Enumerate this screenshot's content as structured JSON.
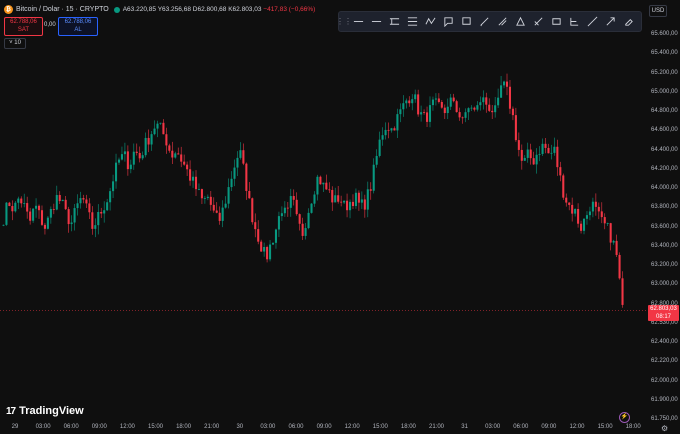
{
  "header": {
    "symbol": "Bitcoin / Dolar · 15 · CRYPTO",
    "ohlc": {
      "open": "A63.220,85",
      "high": "Y63.256,68",
      "low": "D62.800,68",
      "close": "K62.803,03",
      "change": "−417,83 (−0,66%)"
    },
    "sell": {
      "price": "62.788,06",
      "label": "SAT"
    },
    "spread": "0,00",
    "buy": {
      "price": "62.788,06",
      "label": "AL"
    },
    "indicator_count": "10"
  },
  "toolbar": {
    "tools": [
      "horizontal-line-icon",
      "ray-icon",
      "parallel-channel-icon",
      "fib-icon",
      "pattern-icon",
      "text-icon",
      "callout-icon",
      "brush-icon",
      "ruler-icon",
      "triangle-icon",
      "measure-icon",
      "rectangle-icon",
      "position-icon",
      "trendline-icon",
      "arrow-icon",
      "eraser-icon"
    ]
  },
  "currency": "USD",
  "current_price": {
    "price": "62.803,03",
    "countdown": "08:17"
  },
  "y_axis": {
    "labels": [
      "65.600,00",
      "65.400,00",
      "65.200,00",
      "65.000,00",
      "64.800,00",
      "64.600,00",
      "64.400,00",
      "64.200,00",
      "64.000,00",
      "63.800,00",
      "63.600,00",
      "63.400,00",
      "63.200,00",
      "63.000,00",
      "62.800,00",
      "62.530,00",
      "62.400,00",
      "62.220,00",
      "62.000,00",
      "61.900,00",
      "61.750,00"
    ]
  },
  "x_axis": {
    "labels": [
      "29",
      "03:00",
      "06:00",
      "09:00",
      "12:00",
      "15:00",
      "18:00",
      "21:00",
      "30",
      "03:00",
      "06:00",
      "09:00",
      "12:00",
      "15:00",
      "18:00",
      "21:00",
      "31",
      "03:00",
      "06:00",
      "09:00",
      "12:00",
      "15:00",
      "18:00"
    ]
  },
  "branding": {
    "logo_text": "TradingView",
    "logo_mark": "17"
  },
  "colors": {
    "up": "#089981",
    "down": "#f23645",
    "background": "#0f0f0f"
  },
  "chart_data": {
    "type": "candlestick",
    "title": "",
    "ylim": [
      61750,
      65700
    ],
    "close_path": [
      63700,
      63850,
      63780,
      63900,
      63800,
      63650,
      63820,
      63700,
      63600,
      63750,
      63900,
      63850,
      63720,
      63650,
      63800,
      63900,
      63750,
      63600,
      63700,
      63800,
      63900,
      64100,
      64250,
      64300,
      64200,
      64350,
      64280,
      64400,
      64500,
      64600,
      64550,
      64450,
      64300,
      64350,
      64250,
      64150,
      64050,
      63950,
      63850,
      63900,
      63750,
      63650,
      63800,
      64000,
      64200,
      64350,
      64100,
      63800,
      63600,
      63450,
      63300,
      63450,
      63600,
      63800,
      63700,
      63900,
      63650,
      63550,
      63750,
      63950,
      64100,
      64000,
      63950,
      63850,
      63900,
      63800,
      63850,
      63900,
      63800,
      63850,
      64000,
      64250,
      64500,
      64600,
      64550,
      64650,
      64750,
      64850,
      64900,
      64750,
      64650,
      64700,
      64800,
      64750,
      64700,
      64850,
      64750,
      64700,
      64650,
      64800,
      64700,
      64850,
      64800,
      64750,
      64700,
      65000,
      64900,
      64700,
      64400,
      64200,
      64300,
      64250,
      64350,
      64400,
      64300,
      64350,
      64100,
      63900,
      63800,
      63750,
      63600,
      63700,
      63850,
      63750,
      63650,
      63600,
      63500,
      63300,
      62803
    ],
    "high": 65300,
    "low": 62800,
    "last": 62803.03
  }
}
